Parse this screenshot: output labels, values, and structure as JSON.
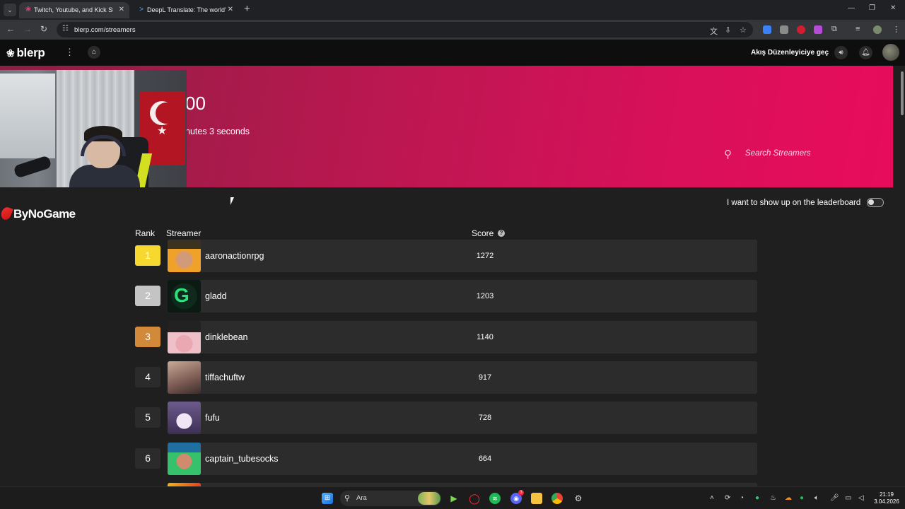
{
  "browser": {
    "tabs": [
      {
        "title": "Twitch, Youtube, and Kick Streamers",
        "active": true
      },
      {
        "title": "DeepL Translate: The world's most accurate translator",
        "active": false
      }
    ],
    "url": "blerp.com/streamers",
    "icons": [
      "tab-list-icon",
      "close-icon",
      "new-tab-icon",
      "minimize-icon",
      "maximize-icon",
      "window-close-icon",
      "back-icon",
      "forward-icon",
      "reload-icon",
      "site-info-icon",
      "translate-icon",
      "install-icon",
      "bookmark-star-icon",
      "extensions-icon",
      "reading-list-icon",
      "profile-icon",
      "menu-icon"
    ]
  },
  "site": {
    "logo_text": "blerp",
    "header_link": "Akış Düzenleyiciye geç",
    "hero": {
      "amount_fragment": "00",
      "time_fragment": "nutes 3 seconds",
      "search_placeholder": "Search Streamers"
    },
    "brand_text": "ByNoGame",
    "leaderboard_toggle_label": "I want to show up on the leaderboard",
    "leaderboard_toggle_on": false,
    "columns": {
      "rank": "Rank",
      "streamer": "Streamer",
      "score": "Score"
    },
    "rows": [
      {
        "rank": "1",
        "name": "aaronactionrpg",
        "score": "1272",
        "medal": "gold"
      },
      {
        "rank": "2",
        "name": "gladd",
        "score": "1203",
        "medal": "silver"
      },
      {
        "rank": "3",
        "name": "dinklebean",
        "score": "1140",
        "medal": "bronze"
      },
      {
        "rank": "4",
        "name": "tiffachuftw",
        "score": "917",
        "medal": "none"
      },
      {
        "rank": "5",
        "name": "fufu",
        "score": "728",
        "medal": "none"
      },
      {
        "rank": "6",
        "name": "captain_tubesocks",
        "score": "664",
        "medal": "none"
      }
    ],
    "colors": {
      "hero_start": "#8c1f44",
      "hero_end": "#e80c5c",
      "gold": "#f7d82e",
      "silver": "#c4c4c4",
      "bronze": "#d3893a"
    }
  },
  "taskbar": {
    "search_text": "Ara",
    "time": "21:19",
    "date": "3.04.2026",
    "discord_badge": "3"
  }
}
